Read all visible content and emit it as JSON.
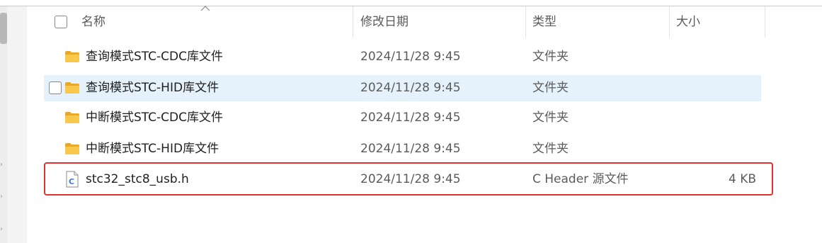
{
  "header": {
    "name_label": "名称",
    "date_label": "修改日期",
    "type_label": "类型",
    "size_label": "大小"
  },
  "rows": [
    {
      "name": "查询模式STC-CDC库文件",
      "date": "2024/11/28 9:45",
      "type": "文件夹",
      "size": "",
      "icon": "folder-icon"
    },
    {
      "name": "查询模式STC-HID库文件",
      "date": "2024/11/28 9:45",
      "type": "文件夹",
      "size": "",
      "icon": "folder-icon"
    },
    {
      "name": "中断模式STC-CDC库文件",
      "date": "2024/11/28 9:45",
      "type": "文件夹",
      "size": "",
      "icon": "folder-icon"
    },
    {
      "name": "中断模式STC-HID库文件",
      "date": "2024/11/28 9:45",
      "type": "文件夹",
      "size": "",
      "icon": "folder-icon"
    },
    {
      "name": "stc32_stc8_usb.h",
      "date": "2024/11/28 9:45",
      "type": "C Header 源文件",
      "size": "4 KB",
      "icon": "c-header-file-icon"
    }
  ],
  "colors": {
    "hover_row": "#e5f1fb",
    "highlight_border": "#e0322c",
    "folder_yellow": "#f5c242"
  }
}
